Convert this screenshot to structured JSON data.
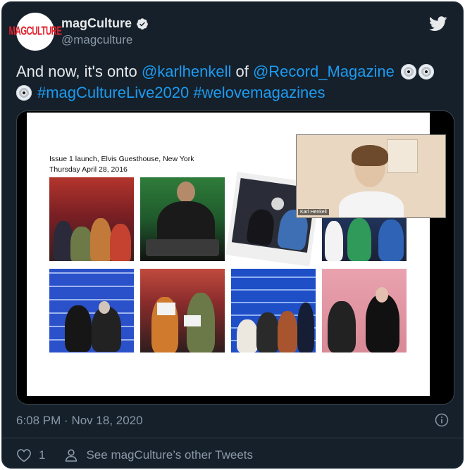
{
  "author": {
    "avatar_text": "MAGCULTURE",
    "name": "magCulture",
    "handle": "@magculture"
  },
  "tweet": {
    "text_lead": "And now, it's onto ",
    "mention_1": "@karlhenkell",
    "text_of": " of ",
    "mention_2": "@Record_Magazine",
    "hashtag_1": "#magCultureLive2020",
    "hashtag_2": "#welovemagazines",
    "emoji": "optical-disc-icon"
  },
  "media": {
    "caption_line_1": "Issue 1 launch, Elvis Guesthouse, New York",
    "caption_line_2": "Thursday April 28, 2016",
    "video_participant": "Karl Henkell"
  },
  "meta": {
    "time": "6:08 PM",
    "separator": "·",
    "date": "Nov 18, 2020"
  },
  "footer": {
    "like_count": "1",
    "other_tweets": "See magCulture’s other Tweets"
  },
  "colors": {
    "background": "#15202b",
    "link": "#1d9bf0",
    "text": "#e7e9ea",
    "secondary": "#8b98a5",
    "brand_red": "#e4202a"
  }
}
